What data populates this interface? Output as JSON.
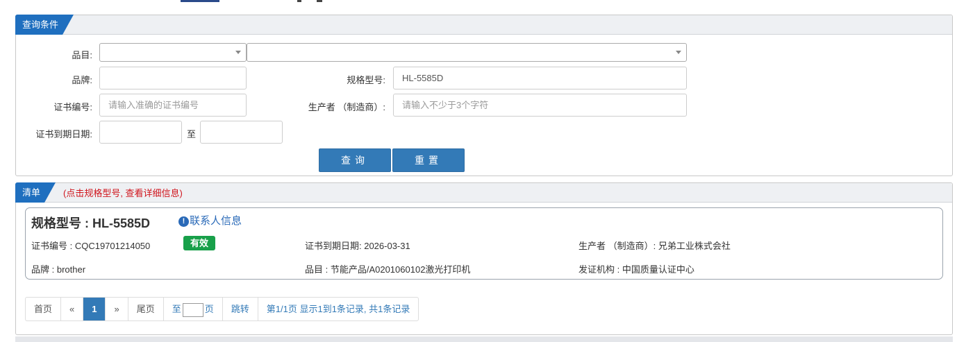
{
  "query": {
    "tab_label": "查询条件",
    "labels": {
      "category": "品目:",
      "brand": "品牌:",
      "model": "规格型号:",
      "cert_no": "证书编号:",
      "manufacturer": "生产者 （制造商）:",
      "expiry": "证书到期日期:",
      "to": "至"
    },
    "fields": {
      "model_value": "HL-5585D",
      "cert_no_placeholder": "请输入准确的证书编号",
      "manufacturer_placeholder": "请输入不少于3个字符"
    },
    "buttons": {
      "search": "查询",
      "reset": "重置"
    }
  },
  "list": {
    "tab_label": "清单",
    "note": "(点击规格型号, 查看详细信息)",
    "item": {
      "title": "规格型号 : HL-5585D",
      "contact_icon": "info-circle-icon",
      "contact_label": "联系人信息",
      "cert_no": "证书编号 : CQC19701214050",
      "status": "有效",
      "expiry": "证书到期日期: 2026-03-31",
      "manufacturer": "生产者 （制造商）: 兄弟工业株式会社",
      "brand": "品牌 : brother",
      "category": "品目 : 节能产品/A0201060102激光打印机",
      "issuer": "发证机构 : 中国质量认证中心"
    },
    "colors": {
      "primary": "#337ab7",
      "status_green": "#18a04a",
      "note_red": "#d0141c"
    }
  },
  "pager": {
    "first": "首页",
    "prev": "«",
    "current": "1",
    "next": "»",
    "last": "尾页",
    "goto_prefix": "至",
    "goto_suffix": "页",
    "jump": "跳转",
    "summary": "第1/1页  显示1到1条记录, 共1条记录"
  }
}
